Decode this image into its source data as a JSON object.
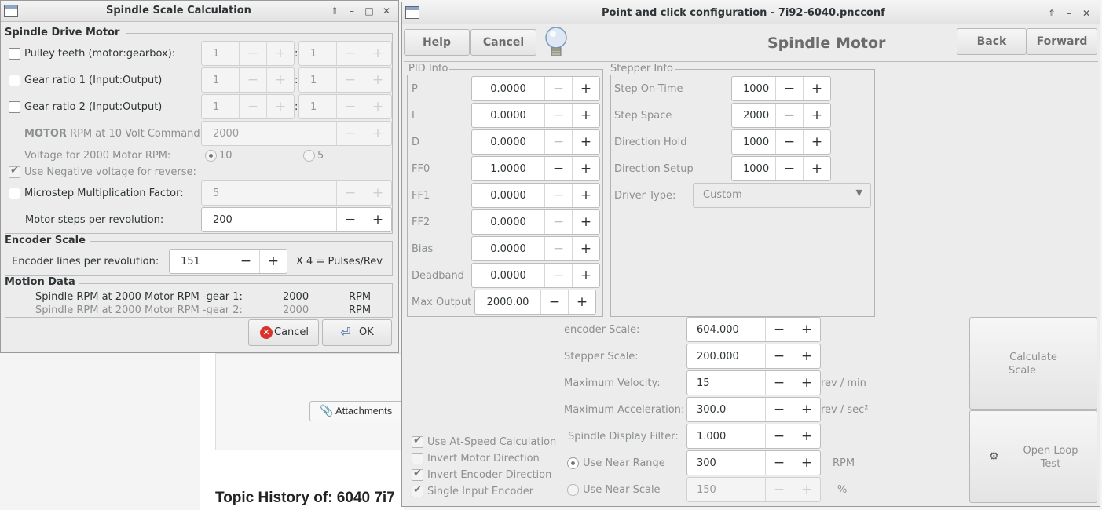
{
  "background_page": {
    "attachments_label": "Attachments",
    "topic_title": "Topic History of: 6040 7i7"
  },
  "dialog": {
    "title": "Spindle Scale Calculation",
    "drive_motor_section": "Spindle Drive Motor",
    "pulley_label": "Pulley teeth (motor:gearbox):",
    "pulley_a": "1",
    "pulley_b": "1",
    "gear1_label": "Gear ratio 1 (Input:Output)",
    "gear1_a": "1",
    "gear1_b": "1",
    "gear2_label": "Gear ratio 2 (Input:Output)",
    "gear2_a": "1",
    "gear2_b": "1",
    "ratio_sep": ":",
    "motor_rpm_label_bold": "MOTOR",
    "motor_rpm_label_rest": "RPM at 10 Volt Command",
    "motor_rpm_value": "2000",
    "voltage_label": "Voltage for 2000 Motor RPM:",
    "voltage_opt1": "10",
    "voltage_opt2": "5",
    "neg_voltage_label": "Use Negative voltage for reverse:",
    "microstep_label": "Microstep Multiplication Factor:",
    "microstep_value": "5",
    "steps_label": "Motor steps per revolution:",
    "steps_value": "200",
    "encoder_section": "Encoder Scale",
    "encoder_lines_label": "Encoder lines per revolution:",
    "encoder_lines_value": "151",
    "encoder_suffix": "X 4 = Pulses/Rev",
    "motion_section": "Motion Data",
    "motion_rows": [
      {
        "label": "Spindle RPM at 2000 Motor RPM -gear 1:",
        "value": "2000",
        "unit": "RPM"
      },
      {
        "label": "Spindle RPM at 2000 Motor RPM -gear 2:",
        "value": "2000",
        "unit": "RPM"
      }
    ],
    "cancel_label": "Cancel",
    "ok_label": "OK"
  },
  "main": {
    "title": "Point and click configuration - 7i92-6040.pncconf",
    "page_title": "Spindle Motor",
    "help_label": "Help",
    "cancel_label": "Cancel",
    "back_label": "Back",
    "forward_label": "Forward",
    "pid_section": "PID Info",
    "pid_rows": [
      {
        "label": "P",
        "value": "0.0000"
      },
      {
        "label": "I",
        "value": "0.0000"
      },
      {
        "label": "D",
        "value": "0.0000"
      },
      {
        "label": "FF0",
        "value": "1.0000"
      },
      {
        "label": "FF1",
        "value": "0.0000"
      },
      {
        "label": "FF2",
        "value": "0.0000"
      },
      {
        "label": "Bias",
        "value": "0.0000"
      },
      {
        "label": "Deadband",
        "value": "0.0000"
      }
    ],
    "max_output_label": "Max Output",
    "max_output_value": "2000.00",
    "stepper_section": "Stepper Info",
    "stepper_rows": [
      {
        "label": "Step On-Time",
        "value": "1000"
      },
      {
        "label": "Step Space",
        "value": "2000"
      },
      {
        "label": "Direction Hold",
        "value": "1000"
      },
      {
        "label": "Direction Setup",
        "value": "1000"
      }
    ],
    "driver_type_label": "Driver Type:",
    "driver_type_value": "Custom",
    "encoder_scale_label": "encoder Scale:",
    "encoder_scale_value": "604.000",
    "stepper_scale_label": "Stepper Scale:",
    "stepper_scale_value": "200.000",
    "max_velocity_label": "Maximum Velocity:",
    "max_velocity_value": "15",
    "max_velocity_unit": "rev / min",
    "max_accel_label": "Maximum Acceleration:",
    "max_accel_value": "300.0",
    "max_accel_unit": "rev / sec²",
    "display_filter_label": "Spindle Display Filter:",
    "display_filter_value": "1.000",
    "near_range_label": "Use Near Range",
    "near_range_value": "300",
    "near_range_unit": "RPM",
    "near_scale_label": "Use Near Scale",
    "near_scale_value": "150",
    "near_scale_unit": "%",
    "at_speed_label": "Use At-Speed Calculation",
    "invert_motor_label": "Invert Motor Direction",
    "invert_encoder_label": "Invert Encoder Direction",
    "single_input_label": "Single Input Encoder",
    "calc_scale_line1": "Calculate",
    "calc_scale_line2": "Scale",
    "open_loop_line1": "Open Loop",
    "open_loop_line2": "Test"
  }
}
